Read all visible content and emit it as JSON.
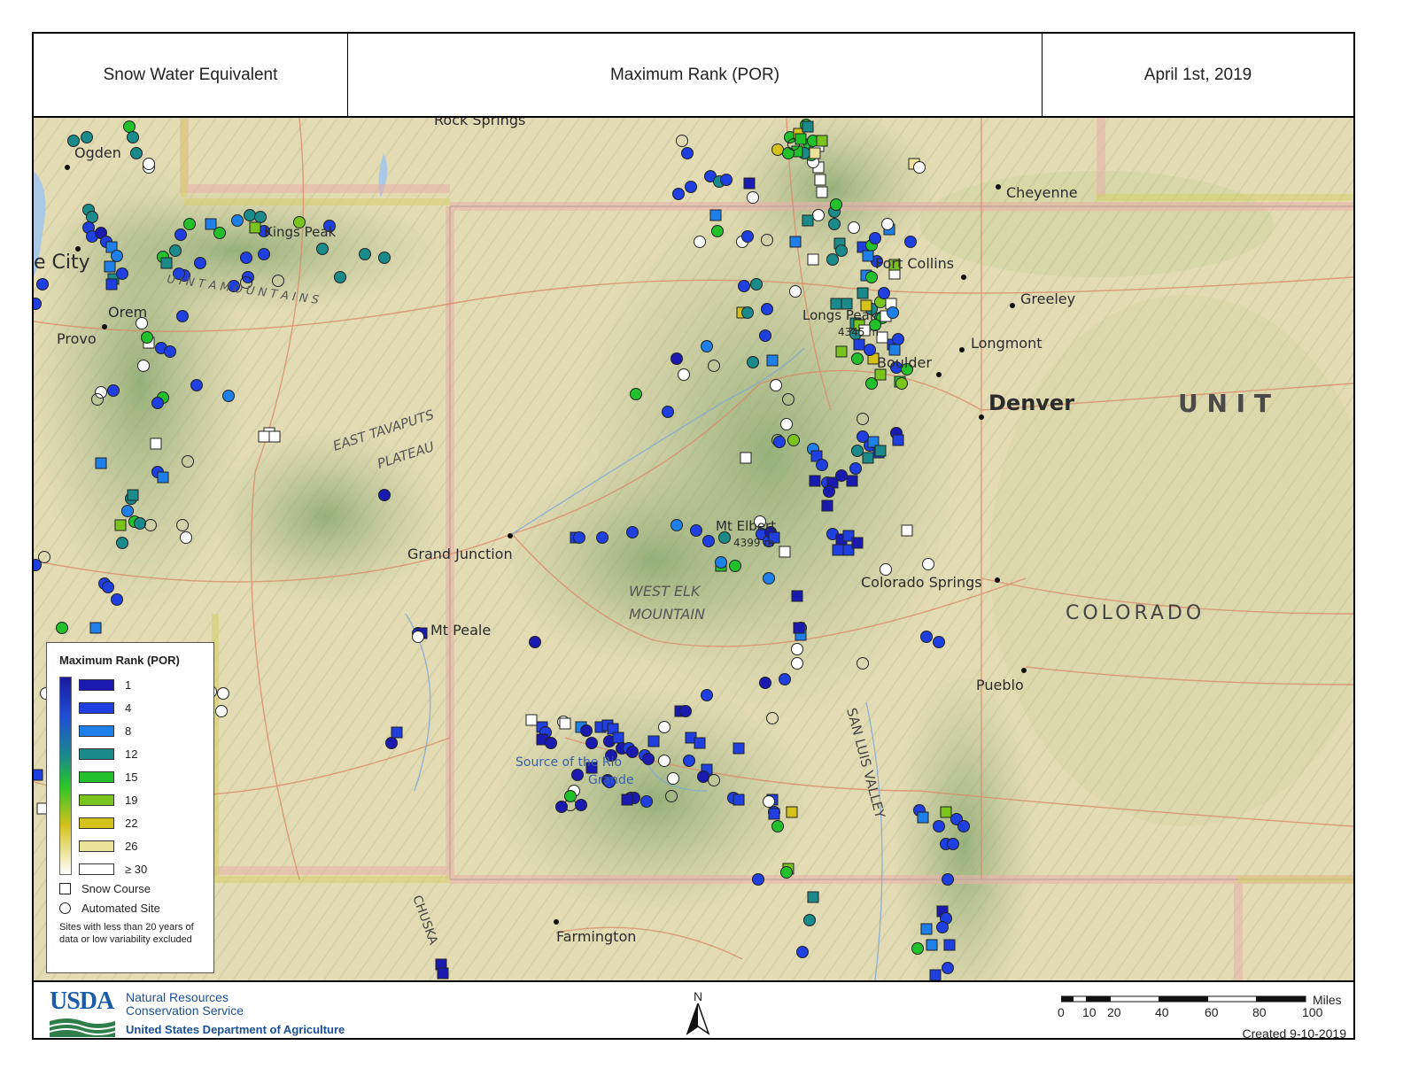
{
  "header": {
    "left_title": "Snow Water Equivalent",
    "center_title": "Maximum Rank (POR)",
    "right_title": "April 1st, 2019"
  },
  "map": {
    "place_labels": {
      "ogden": "Ogden",
      "salt_lake": "e City",
      "orem": "Orem",
      "provo": "Provo",
      "kings_peak": "Kings Peak",
      "rock_springs": "Rock Springs",
      "cheyenne": "Cheyenne",
      "fort_collins": "Fort Collins",
      "greeley": "Greeley",
      "longs_peak": "Longs Peak",
      "longs_peak_elev": "4345 m",
      "longmont": "Longmont",
      "boulder": "Boulder",
      "denver": "Denver",
      "unit": "U N I T",
      "grand_junction": "Grand Junction",
      "mt_elbert": "Mt Elbert",
      "mt_elbert_elev": "4399 m",
      "colorado_springs": "Colorado Springs",
      "colorado": "COLORADO",
      "mt_peale": "Mt Peale",
      "west_elk_1": "WEST ELK",
      "west_elk_2": "MOUNTAIN",
      "pueblo": "Pueblo",
      "source_1": "Source of the Rio",
      "source_2": "Grande",
      "san_luis_valley": "SAN LUIS VALLEY",
      "farmington": "Farmington",
      "east_tavaputs": "EAST TAVAPUTS",
      "plateau": "PLATEAU",
      "uinta": "U I N T A     M O U N T A I N S",
      "chuska": "CHUSKA"
    }
  },
  "legend": {
    "title": "Maximum Rank (POR)",
    "classes": [
      {
        "label": "1",
        "color": "#1a1ab0"
      },
      {
        "label": "4",
        "color": "#1f3fe0"
      },
      {
        "label": "8",
        "color": "#1f7fe8"
      },
      {
        "label": "12",
        "color": "#1a8a8a"
      },
      {
        "label": "15",
        "color": "#22c02a"
      },
      {
        "label": "19",
        "color": "#7ac41e"
      },
      {
        "label": "22",
        "color": "#d4c21a"
      },
      {
        "label": "26",
        "color": "#ece39a"
      },
      {
        "label": "≥ 30",
        "color": "#ffffff"
      }
    ],
    "snow_course": "Snow Course",
    "automated_site": "Automated Site",
    "note": "Sites with less than 20 years of data or low variability excluded"
  },
  "footer": {
    "usda": "USDA",
    "agency_line1": "Natural Resources",
    "agency_line2": "Conservation Service",
    "department": "United States Department of Agriculture",
    "north": "N",
    "scale_unit": "Miles",
    "scale_ticks": [
      "0",
      "10",
      "20",
      "40",
      "60",
      "80",
      "100"
    ],
    "created": "Created 9-10-2019"
  }
}
